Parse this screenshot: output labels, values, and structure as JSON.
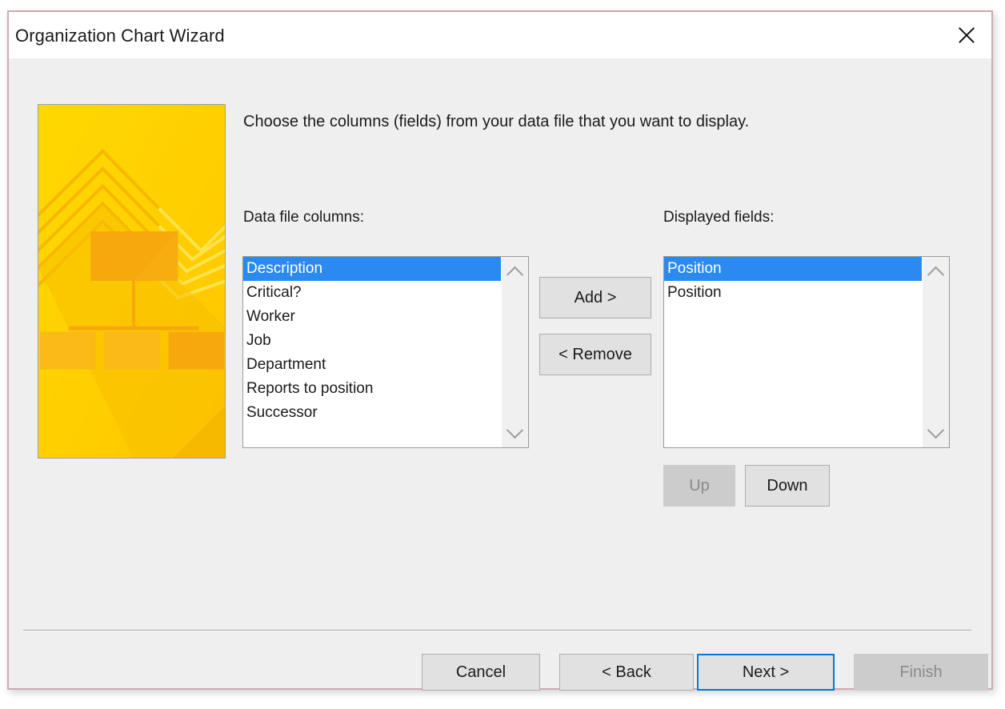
{
  "window": {
    "title": "Organization Chart Wizard",
    "close_icon": "close-icon",
    "border_color": "#cbabb0",
    "titlebar_bg": "#ffffff",
    "body_bg": "#efefef"
  },
  "banner": {
    "alt": "organization-chart-illustration",
    "base_color": "#ffd400",
    "accent_color": "#f9a825",
    "shadow_color": "#f5b200"
  },
  "main": {
    "instruction": "Choose the columns (fields) from your data file that you want to display.",
    "left_list": {
      "label": "Data file columns:",
      "items": [
        {
          "text": "Description",
          "selected": true
        },
        {
          "text": "Critical?",
          "selected": false
        },
        {
          "text": "Worker",
          "selected": false
        },
        {
          "text": "Job",
          "selected": false
        },
        {
          "text": "Department",
          "selected": false
        },
        {
          "text": "Reports to position",
          "selected": false
        },
        {
          "text": "Successor",
          "selected": false
        }
      ],
      "scroll_up_icon": "chevron-up-icon",
      "scroll_down_icon": "chevron-down-icon"
    },
    "right_list": {
      "label": "Displayed fields:",
      "items": [
        {
          "text": "Position",
          "selected": true
        },
        {
          "text": "Position",
          "selected": false
        }
      ],
      "scroll_up_icon": "chevron-up-icon",
      "scroll_down_icon": "chevron-down-icon"
    },
    "transfer_buttons": {
      "add_label": "Add >",
      "remove_label": "< Remove"
    },
    "reorder_buttons": {
      "up_label": "Up",
      "up_disabled": true,
      "down_label": "Down",
      "down_disabled": false
    }
  },
  "footer": {
    "cancel_label": "Cancel",
    "back_label": "< Back",
    "next_label": "Next >",
    "next_focused": true,
    "finish_label": "Finish",
    "finish_disabled": true,
    "focus_color": "#0078d7"
  },
  "colors": {
    "selection_blue": "#2a8aef",
    "button_face": "#e1e1e1",
    "button_border": "#adadad",
    "disabled_face": "#cccccc",
    "disabled_text": "#8a8a8a"
  }
}
